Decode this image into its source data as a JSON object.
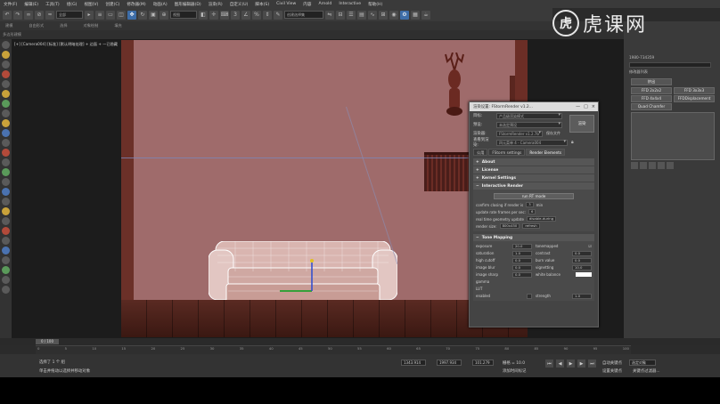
{
  "menu": [
    "文件(F)",
    "编辑(E)",
    "工具(T)",
    "组(G)",
    "视图(V)",
    "创建(C)",
    "修改器(M)",
    "动画(A)",
    "图形编辑器(D)",
    "渲染(R)",
    "自定义(U)",
    "脚本(S)",
    "Civil View",
    "内容",
    "Arnold",
    "Interactive",
    "帮助(H)"
  ],
  "toolbar": {
    "selection_filter": "全部",
    "view_select": "视图",
    "named_selection": "创建选择集"
  },
  "ribbon": {
    "tabs": [
      "建模",
      "自由形式",
      "选择",
      "对象绘制",
      "填充"
    ],
    "sub_label": "多边形建模"
  },
  "viewport": {
    "label": "[+] [Camera004] [标准] [默认明暗处理] + 边面 + 一已隐藏"
  },
  "logo": {
    "glyph": "虎",
    "text": "虎课网"
  },
  "right_panel": {
    "line1": "1980-734359",
    "modifier_list_label": "修改器列表",
    "buttons": [
      "挤出",
      "FFD 2x2x2",
      "FFD 3x3x3",
      "FFD 4x4x4",
      "FFDDisplacement",
      "Quad Chamfer"
    ]
  },
  "dialog": {
    "title": "渲染设置: FStormRender v1.2...",
    "controls": [
      "—",
      "□",
      "×"
    ],
    "rows": [
      {
        "label": "目标:",
        "value": "产品级渲染模式"
      },
      {
        "label": "预设:",
        "value": "未选定预设"
      },
      {
        "label": "渲染器:",
        "value": "FStormRender v1.2.7b"
      }
    ],
    "save_file": "保存文件",
    "view_label": "查看到渲染:",
    "view_value": "四元菜单 4 - Camera004",
    "render_button": "渲染",
    "tabs": [
      "公用",
      "FStorm settings",
      "Render Elements"
    ],
    "rollouts": [
      "About",
      "License",
      "Kernel Settings",
      "Interactive Render"
    ],
    "interactive": {
      "run_button": "run RT mode",
      "confirm_label": "confirm closing if render is",
      "confirm_value": "3",
      "confirm_unit": "min",
      "update_label": "update rate frames per sec:",
      "update_value": "6",
      "realtime_label": "real time geometry update",
      "realtime_value": "disable-during",
      "size_label": "render size:",
      "size_value": "800x450",
      "refresh_button": "refresh"
    },
    "tone_mapping": {
      "title": "Tone Mapping",
      "cells": [
        {
          "label": "exposure",
          "value": "20.0"
        },
        {
          "label": "tonemapped",
          "value": "☑"
        },
        {
          "label": "saturation",
          "value": "1.0"
        },
        {
          "label": "contrast",
          "value": "0.0"
        },
        {
          "label": "high cutoff",
          "value": "0.0"
        },
        {
          "label": "burn value",
          "value": "0.0"
        },
        {
          "label": "image blur",
          "value": "0.0"
        },
        {
          "label": "vignetting",
          "value": "10.0"
        },
        {
          "label": "image sharp",
          "value": "0.0"
        },
        {
          "label": "white balance",
          "value": ""
        },
        {
          "label": "gamma",
          "value": ""
        },
        {
          "label": "LUT",
          "value": ""
        },
        {
          "label": "enabled",
          "value": ""
        },
        {
          "label": "strength",
          "value": "1.0"
        }
      ]
    }
  },
  "timeline": {
    "frame": "0 / 100",
    "ticks": [
      "0",
      "5",
      "10",
      "15",
      "20",
      "25",
      "30",
      "35",
      "40",
      "45",
      "50",
      "55",
      "60",
      "65",
      "70",
      "75",
      "80",
      "85",
      "90",
      "95",
      "100"
    ]
  },
  "status": {
    "selected": "选择了 1 个 组",
    "hint": "单击并拖动以选择并移动对象",
    "x": "1343.914",
    "y": "1997.934",
    "z": "101.279",
    "grid": "栅格 = 10.0",
    "add_key": "添加时间标记",
    "auto_key": "自动关键点",
    "set_key": "设置关键点",
    "selected_obj": "选定对象",
    "key_filter": "关键点过滤器..."
  }
}
